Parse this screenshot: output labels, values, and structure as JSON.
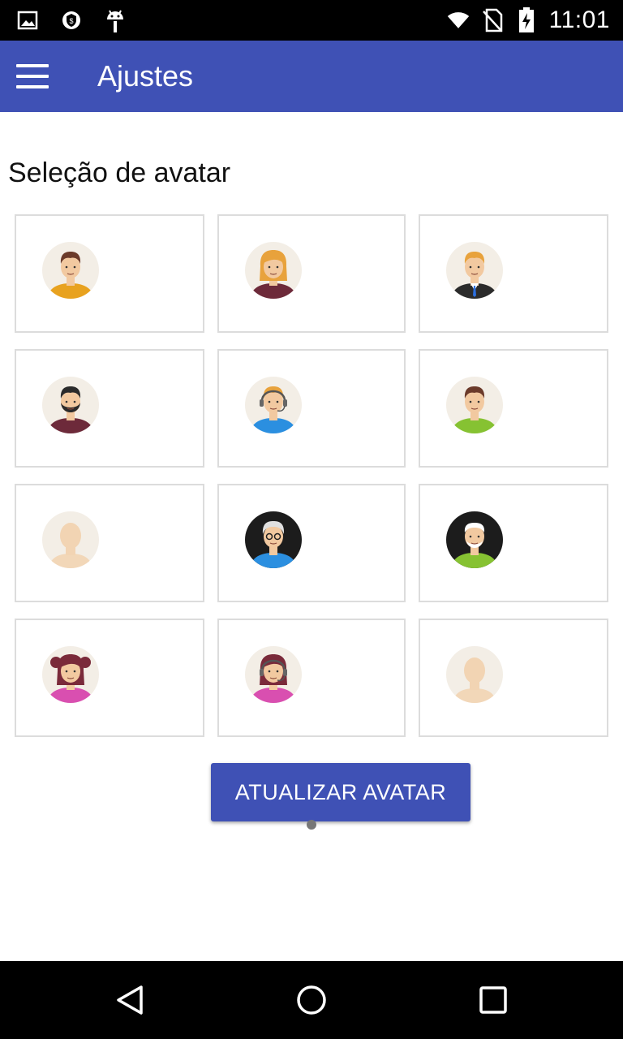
{
  "status_bar": {
    "time": "11:01",
    "left_icons": [
      "image-icon",
      "shield-icon",
      "android-icon"
    ],
    "right_icons": [
      "wifi-icon",
      "no-sim-icon",
      "battery-charging-icon"
    ]
  },
  "app_bar": {
    "title": "Ajustes",
    "menu_icon": "menu-icon",
    "color": "#3f51b5"
  },
  "section_title": "Seleção de avatar",
  "avatars": [
    {
      "name": "man-brown-hair",
      "bg": "#f3eee6",
      "skin": "#f2c9a0",
      "hair": "#6b3a2a",
      "shirt": "#e8a21f",
      "style": "man"
    },
    {
      "name": "woman-blonde",
      "bg": "#f3eee6",
      "skin": "#f2c9a0",
      "hair": "#e8a23c",
      "shirt": "#6d2a3a",
      "style": "woman"
    },
    {
      "name": "businessman-tie",
      "bg": "#f3eee6",
      "skin": "#f2c9a0",
      "hair": "#e8a23c",
      "shirt": "#2b2b2b",
      "style": "suit"
    },
    {
      "name": "man-beard",
      "bg": "#f3eee6",
      "skin": "#f2c9a0",
      "hair": "#2b2b2b",
      "shirt": "#6d2a3a",
      "style": "beard"
    },
    {
      "name": "support-headset-man",
      "bg": "#f3eee6",
      "skin": "#f2c9a0",
      "hair": "#e8a23c",
      "shirt": "#2b8fe0",
      "style": "headset"
    },
    {
      "name": "young-man-green",
      "bg": "#f3eee6",
      "skin": "#f2c9a0",
      "hair": "#6b3a2a",
      "shirt": "#86c232",
      "style": "man"
    },
    {
      "name": "blank-avatar",
      "bg": "#f3eee6",
      "skin": "#f2d4b3",
      "hair": "",
      "shirt": "#f2d4b3",
      "style": "blank"
    },
    {
      "name": "grandma-glasses",
      "bg": "#1c1c1c",
      "skin": "#f2c9a0",
      "hair": "#e0e0e0",
      "shirt": "#2b8fe0",
      "style": "grandma"
    },
    {
      "name": "grandpa-beard",
      "bg": "#1c1c1c",
      "skin": "#f2c9a0",
      "hair": "#ffffff",
      "shirt": "#86c232",
      "style": "grandpa"
    },
    {
      "name": "girl-pigtails",
      "bg": "#f3eee6",
      "skin": "#f2c9a0",
      "hair": "#7a2a3a",
      "shirt": "#d94fb0",
      "style": "girl"
    },
    {
      "name": "support-headset-woman",
      "bg": "#f3eee6",
      "skin": "#f2c9a0",
      "hair": "#7a2a3a",
      "shirt": "#d94fb0",
      "style": "headset-woman"
    },
    {
      "name": "blank-avatar-2",
      "bg": "#f3eee6",
      "skin": "#f2d4b3",
      "hair": "",
      "shirt": "#f2d4b3",
      "style": "blank"
    }
  ],
  "update_button": "ATUALIZAR AVATAR",
  "nav_bar": {
    "back_icon": "back-triangle-icon",
    "home_icon": "home-circle-icon",
    "recents_icon": "recents-square-icon"
  }
}
